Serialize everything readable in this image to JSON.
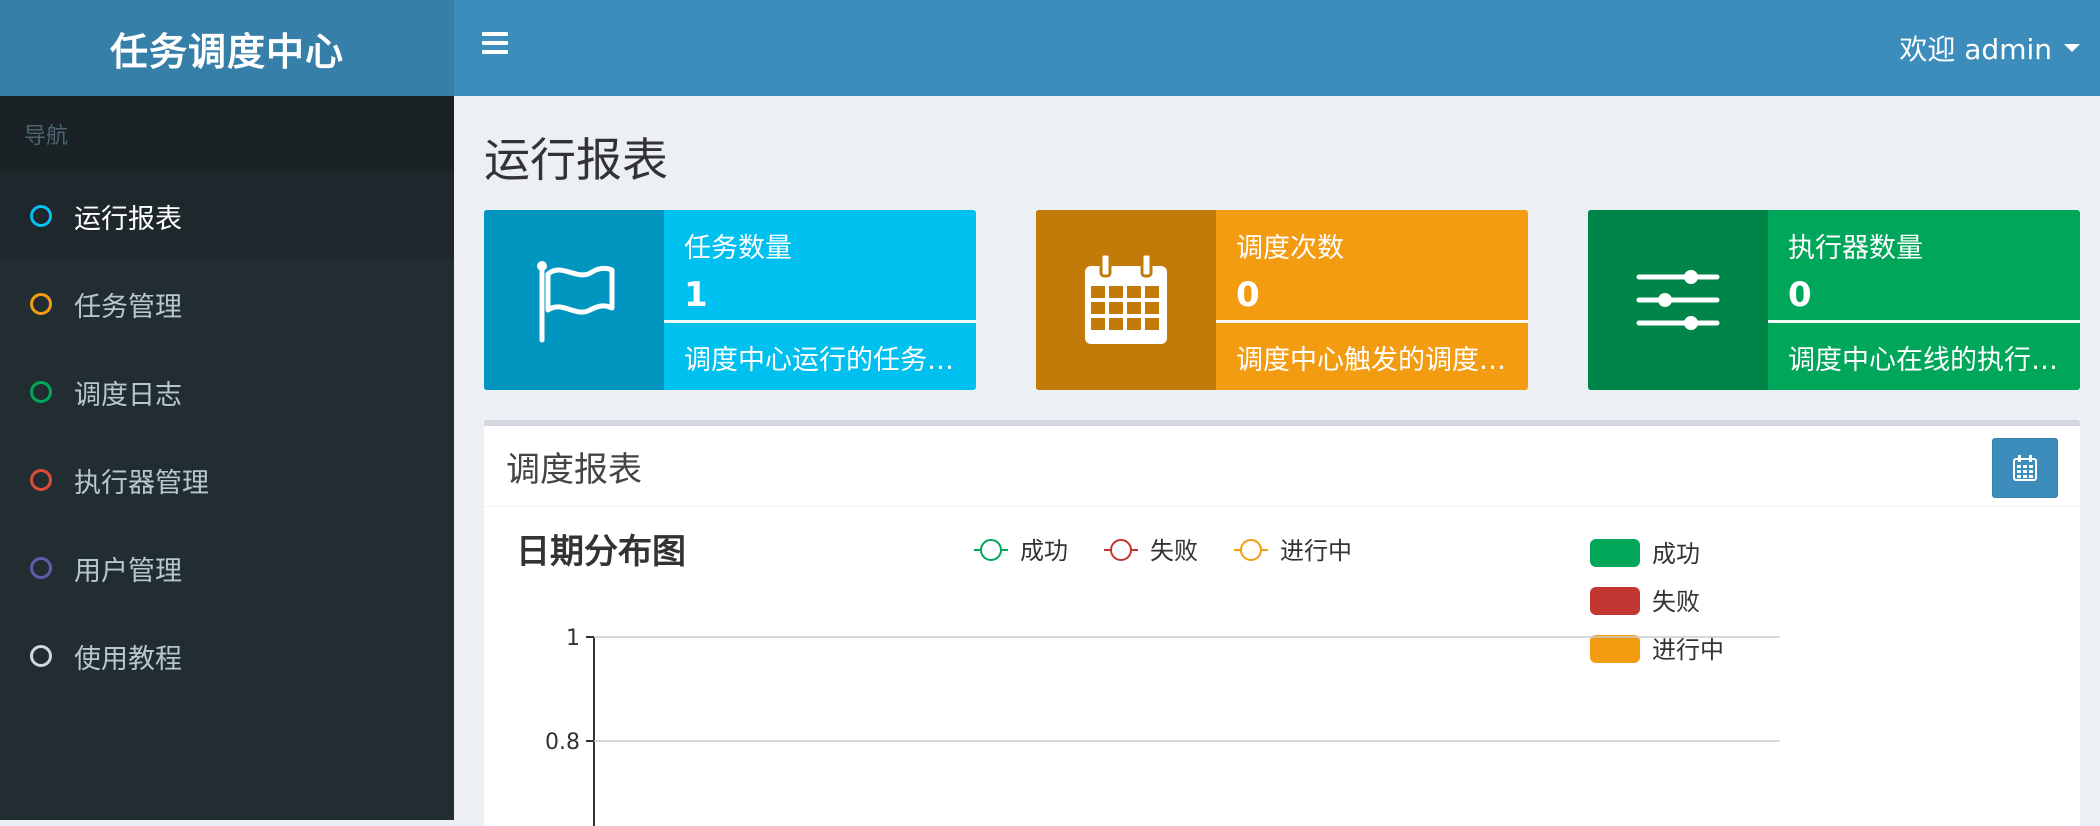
{
  "header": {
    "brand": "任务调度中心",
    "user_menu": "欢迎 admin"
  },
  "sidebar": {
    "nav_header": "导航",
    "items": [
      {
        "label": "运行报表",
        "color": "#00c0ef"
      },
      {
        "label": "任务管理",
        "color": "#f39c12"
      },
      {
        "label": "调度日志",
        "color": "#00a65a"
      },
      {
        "label": "执行器管理",
        "color": "#dd4b39"
      },
      {
        "label": "用户管理",
        "color": "#605ca8"
      },
      {
        "label": "使用教程",
        "color": "#d2d6de"
      }
    ]
  },
  "page": {
    "title": "运行报表"
  },
  "info_boxes": [
    {
      "title": "任务数量",
      "number": "1",
      "desc": "调度中心运行的任务数量",
      "icon": "flag-icon"
    },
    {
      "title": "调度次数",
      "number": "0",
      "desc": "调度中心触发的调度次数",
      "icon": "calendar-icon"
    },
    {
      "title": "执行器数量",
      "number": "0",
      "desc": "调度中心在线的执行器机器数量",
      "icon": "sliders-icon"
    }
  ],
  "panel": {
    "title": "调度报表",
    "calendar_button_icon": "calendar-icon"
  },
  "chart_data": {
    "type": "line",
    "title": "日期分布图",
    "series": [
      {
        "name": "成功",
        "color": "#00a65a",
        "values": []
      },
      {
        "name": "失败",
        "color": "#c23531",
        "values": []
      },
      {
        "name": "进行中",
        "color": "#f39c12",
        "values": []
      }
    ],
    "yticks": [
      "1",
      "0.8"
    ],
    "ylim": [
      0,
      1
    ],
    "pie_legend": [
      {
        "name": "成功",
        "color": "#00a65a"
      },
      {
        "name": "失败",
        "color": "#c23531"
      },
      {
        "name": "进行中",
        "color": "#f39c12"
      }
    ]
  }
}
